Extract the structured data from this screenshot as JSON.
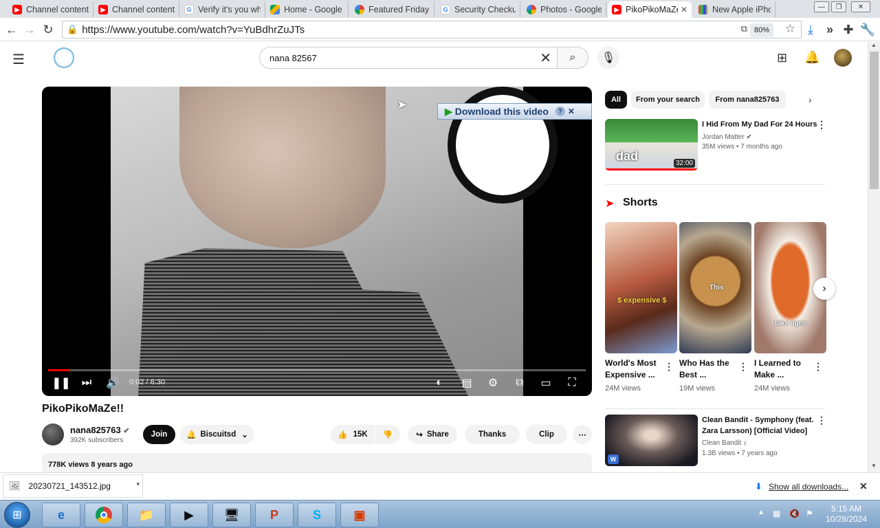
{
  "browser": {
    "tabs": [
      {
        "label": "Channel content",
        "icon": "youtube-icon",
        "color": "#ff0000"
      },
      {
        "label": "Channel content",
        "icon": "youtube-icon",
        "color": "#ff0000"
      },
      {
        "label": "Verify it's you wh",
        "icon": "google-icon",
        "color": "#4285f4"
      },
      {
        "label": "Home - Google",
        "icon": "google-drive-icon",
        "color": "#0f9d58"
      },
      {
        "label": "Featured Friday",
        "icon": "pinwheel-icon",
        "color": "#f4b400"
      },
      {
        "label": "Security Checkup",
        "icon": "google-icon",
        "color": "#4285f4"
      },
      {
        "label": "Photos - Google",
        "icon": "google-photos-icon",
        "color": "#db4437"
      },
      {
        "label": "PikoPikoMaZe",
        "icon": "youtube-icon",
        "color": "#ff0000",
        "active": true
      },
      {
        "label": "New Apple iPho",
        "icon": "tv-icon",
        "color": "#555555"
      }
    ],
    "url": "https://www.youtube.com/watch?v=YuBdhrZuJTs",
    "zoom": "80%"
  },
  "youtube": {
    "search_value": "nana 82567",
    "video": {
      "title": "PikoPikoMaZe!!",
      "time": "0:02 / 6:30",
      "progress_fraction": 0.005,
      "download_overlay": "Download this video"
    },
    "channel": {
      "name": "nana825763",
      "subscribers": "392K subscribers",
      "join": "Join",
      "subscribed": "Biscuitsd"
    },
    "actions": {
      "likes": "15K",
      "share": "Share",
      "thanks": "Thanks",
      "clip": "Clip"
    },
    "description_meta": "778K views  8 years ago",
    "chips": [
      "All",
      "From your search",
      "From nana825763"
    ],
    "rec1": {
      "title": "I Hid From My Dad For 24 Hours",
      "channel": "Jordan Matter",
      "meta": "35M views  •  7 months ago",
      "duration": "32:00",
      "thumb_text": "dad"
    },
    "shorts_heading": "Shorts",
    "shorts": [
      {
        "title": "World's Most Expensive ...",
        "views": "24M views",
        "caption": "$ expensive $",
        "color": "#8a5a2e"
      },
      {
        "title": "Who Has the Best ...",
        "views": "19M views",
        "caption": "This",
        "color": "#b07a3c"
      },
      {
        "title": "I Learned to Make ...",
        "views": "24M views",
        "caption": "take ages",
        "color": "#d8622a"
      }
    ],
    "rec2": {
      "title": "Clean Bandit - Symphony (feat. Zara Larsson) [Official Video]",
      "channel": "Clean Bandit",
      "meta": "1.3B views  •  7 years ago"
    }
  },
  "downloads": {
    "file": "20230721_143512.jpg",
    "show_all": "Show all downloads..."
  },
  "taskbar": {
    "time": "5:15 AM",
    "date": "10/28/2024"
  }
}
